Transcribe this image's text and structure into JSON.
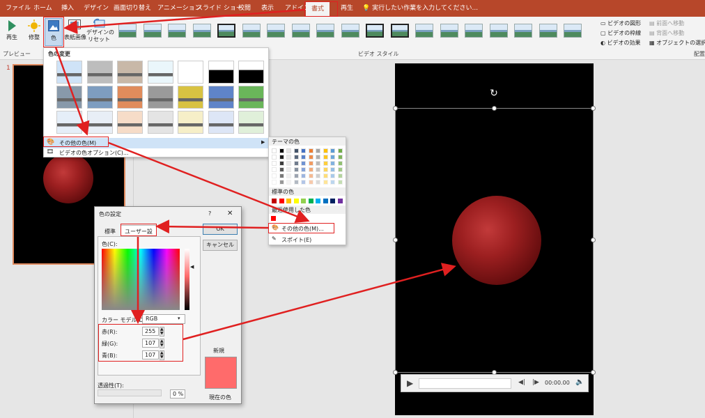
{
  "colors": {
    "tabbar": "#b7472a",
    "highlight": "#e02020",
    "new_color": "#ff6b6b",
    "moon_red": "#9c1f20"
  },
  "tabs": [
    "ファイル",
    "ホーム",
    "挿入",
    "デザイン",
    "画面切り替え",
    "アニメーション",
    "スライド ショー",
    "校閲",
    "表示",
    "アドイン",
    "書式",
    "再生"
  ],
  "tell_me": "実行したい作業を入力してください...",
  "ribbon": {
    "play_label": "再生",
    "preview_group": "プレビュー",
    "adjust_label": "修整",
    "color_label": "色",
    "poster_label": "表紙画像",
    "reset_label1": "デザインの",
    "reset_label2": "リセット",
    "styles_group": "ビデオ スタイル",
    "shape": "ビデオの図形",
    "border": "ビデオの枠線",
    "effects": "ビデオの効果",
    "bring_forward": "前面へ移動",
    "send_backward": "背面へ移動",
    "selection_pane": "オブジェクトの選択と表示",
    "arrange_group": "配置"
  },
  "color_menu": {
    "recolor_title": "色の変更",
    "more_colors": "その他の色(M)",
    "video_color_options": "ビデオの色オプション(C)..."
  },
  "submenu": {
    "theme_colors": "テーマの色",
    "standard_colors": "標準の色",
    "recent_colors": "最近使用した色",
    "more_colors": "その他の色(M)...",
    "eyedropper": "スポイト(E)"
  },
  "dialog": {
    "title": "色の設定",
    "help": "?",
    "close": "✕",
    "tab_standard": "標準",
    "tab_custom": "ユーザー設定",
    "colors_label": "色(C):",
    "model_label": "カラー モデル(D):",
    "model_value": "RGB",
    "red_label": "赤(R):",
    "red_value": "255",
    "green_label": "緑(G):",
    "green_value": "107",
    "blue_label": "青(B):",
    "blue_value": "107",
    "transparency_label": "透過性(T):",
    "transparency_value": "0 %",
    "ok": "OK",
    "cancel": "キャンセル",
    "new_label": "新規",
    "current_label": "現在の色"
  },
  "slide_number": "1",
  "player": {
    "time": "00:00.00"
  }
}
